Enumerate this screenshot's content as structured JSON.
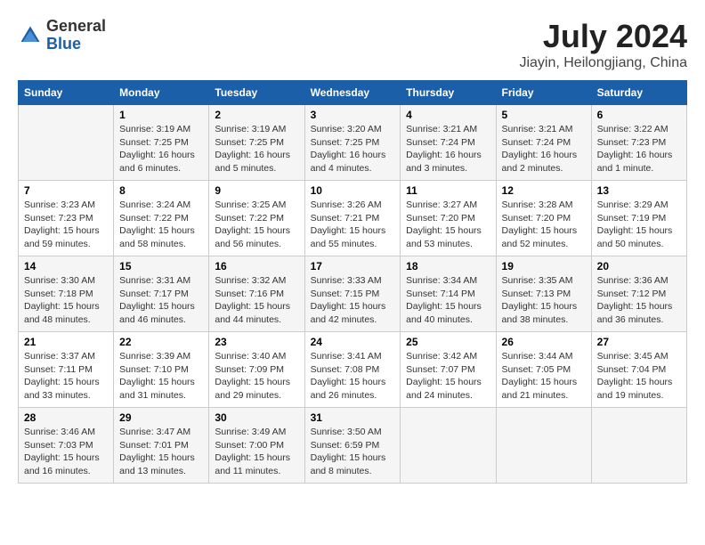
{
  "logo": {
    "general": "General",
    "blue": "Blue"
  },
  "title": "July 2024",
  "subtitle": "Jiayin, Heilongjiang, China",
  "days_of_week": [
    "Sunday",
    "Monday",
    "Tuesday",
    "Wednesday",
    "Thursday",
    "Friday",
    "Saturday"
  ],
  "weeks": [
    [
      {
        "day": "",
        "info": ""
      },
      {
        "day": "1",
        "info": "Sunrise: 3:19 AM\nSunset: 7:25 PM\nDaylight: 16 hours\nand 6 minutes."
      },
      {
        "day": "2",
        "info": "Sunrise: 3:19 AM\nSunset: 7:25 PM\nDaylight: 16 hours\nand 5 minutes."
      },
      {
        "day": "3",
        "info": "Sunrise: 3:20 AM\nSunset: 7:25 PM\nDaylight: 16 hours\nand 4 minutes."
      },
      {
        "day": "4",
        "info": "Sunrise: 3:21 AM\nSunset: 7:24 PM\nDaylight: 16 hours\nand 3 minutes."
      },
      {
        "day": "5",
        "info": "Sunrise: 3:21 AM\nSunset: 7:24 PM\nDaylight: 16 hours\nand 2 minutes."
      },
      {
        "day": "6",
        "info": "Sunrise: 3:22 AM\nSunset: 7:23 PM\nDaylight: 16 hours\nand 1 minute."
      }
    ],
    [
      {
        "day": "7",
        "info": "Sunrise: 3:23 AM\nSunset: 7:23 PM\nDaylight: 15 hours\nand 59 minutes."
      },
      {
        "day": "8",
        "info": "Sunrise: 3:24 AM\nSunset: 7:22 PM\nDaylight: 15 hours\nand 58 minutes."
      },
      {
        "day": "9",
        "info": "Sunrise: 3:25 AM\nSunset: 7:22 PM\nDaylight: 15 hours\nand 56 minutes."
      },
      {
        "day": "10",
        "info": "Sunrise: 3:26 AM\nSunset: 7:21 PM\nDaylight: 15 hours\nand 55 minutes."
      },
      {
        "day": "11",
        "info": "Sunrise: 3:27 AM\nSunset: 7:20 PM\nDaylight: 15 hours\nand 53 minutes."
      },
      {
        "day": "12",
        "info": "Sunrise: 3:28 AM\nSunset: 7:20 PM\nDaylight: 15 hours\nand 52 minutes."
      },
      {
        "day": "13",
        "info": "Sunrise: 3:29 AM\nSunset: 7:19 PM\nDaylight: 15 hours\nand 50 minutes."
      }
    ],
    [
      {
        "day": "14",
        "info": "Sunrise: 3:30 AM\nSunset: 7:18 PM\nDaylight: 15 hours\nand 48 minutes."
      },
      {
        "day": "15",
        "info": "Sunrise: 3:31 AM\nSunset: 7:17 PM\nDaylight: 15 hours\nand 46 minutes."
      },
      {
        "day": "16",
        "info": "Sunrise: 3:32 AM\nSunset: 7:16 PM\nDaylight: 15 hours\nand 44 minutes."
      },
      {
        "day": "17",
        "info": "Sunrise: 3:33 AM\nSunset: 7:15 PM\nDaylight: 15 hours\nand 42 minutes."
      },
      {
        "day": "18",
        "info": "Sunrise: 3:34 AM\nSunset: 7:14 PM\nDaylight: 15 hours\nand 40 minutes."
      },
      {
        "day": "19",
        "info": "Sunrise: 3:35 AM\nSunset: 7:13 PM\nDaylight: 15 hours\nand 38 minutes."
      },
      {
        "day": "20",
        "info": "Sunrise: 3:36 AM\nSunset: 7:12 PM\nDaylight: 15 hours\nand 36 minutes."
      }
    ],
    [
      {
        "day": "21",
        "info": "Sunrise: 3:37 AM\nSunset: 7:11 PM\nDaylight: 15 hours\nand 33 minutes."
      },
      {
        "day": "22",
        "info": "Sunrise: 3:39 AM\nSunset: 7:10 PM\nDaylight: 15 hours\nand 31 minutes."
      },
      {
        "day": "23",
        "info": "Sunrise: 3:40 AM\nSunset: 7:09 PM\nDaylight: 15 hours\nand 29 minutes."
      },
      {
        "day": "24",
        "info": "Sunrise: 3:41 AM\nSunset: 7:08 PM\nDaylight: 15 hours\nand 26 minutes."
      },
      {
        "day": "25",
        "info": "Sunrise: 3:42 AM\nSunset: 7:07 PM\nDaylight: 15 hours\nand 24 minutes."
      },
      {
        "day": "26",
        "info": "Sunrise: 3:44 AM\nSunset: 7:05 PM\nDaylight: 15 hours\nand 21 minutes."
      },
      {
        "day": "27",
        "info": "Sunrise: 3:45 AM\nSunset: 7:04 PM\nDaylight: 15 hours\nand 19 minutes."
      }
    ],
    [
      {
        "day": "28",
        "info": "Sunrise: 3:46 AM\nSunset: 7:03 PM\nDaylight: 15 hours\nand 16 minutes."
      },
      {
        "day": "29",
        "info": "Sunrise: 3:47 AM\nSunset: 7:01 PM\nDaylight: 15 hours\nand 13 minutes."
      },
      {
        "day": "30",
        "info": "Sunrise: 3:49 AM\nSunset: 7:00 PM\nDaylight: 15 hours\nand 11 minutes."
      },
      {
        "day": "31",
        "info": "Sunrise: 3:50 AM\nSunset: 6:59 PM\nDaylight: 15 hours\nand 8 minutes."
      },
      {
        "day": "",
        "info": ""
      },
      {
        "day": "",
        "info": ""
      },
      {
        "day": "",
        "info": ""
      }
    ]
  ]
}
